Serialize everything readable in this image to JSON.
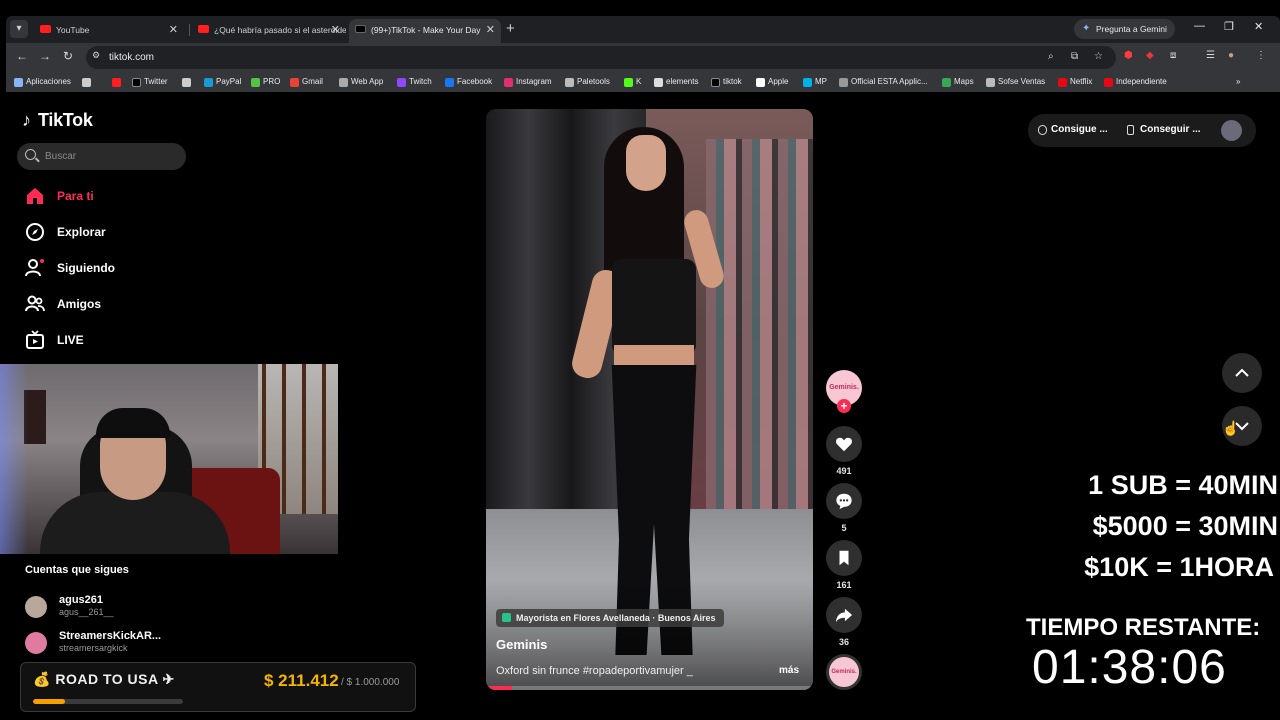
{
  "browser": {
    "tabs": [
      {
        "label": "YouTube"
      },
      {
        "label": "¿Qué habría pasado si el asteroide..."
      },
      {
        "label": "(99+)TikTok - Make Your Day"
      }
    ],
    "new_tab": "+",
    "gemini": "Pregunta a Gemini",
    "url": "tiktok.com",
    "bookmarks": [
      {
        "label": "Aplicaciones",
        "color": "#8ab4f8"
      },
      {
        "label": "",
        "color": "#ff1f1f"
      },
      {
        "label": "Twitter",
        "color": "#000000"
      },
      {
        "label": "",
        "color": "#cccccc"
      },
      {
        "label": "PayPal",
        "color": "#169bd7"
      },
      {
        "label": "PRO",
        "color": "#53c245"
      },
      {
        "label": "Gmail",
        "color": "#ea4335"
      },
      {
        "label": "Web App",
        "color": "#aaaaaa"
      },
      {
        "label": "Twitch",
        "color": "#9146ff"
      },
      {
        "label": "Facebook",
        "color": "#1877f2"
      },
      {
        "label": "Instagram",
        "color": "#e1306c"
      },
      {
        "label": "Paletools",
        "color": "#bbbbbb"
      },
      {
        "label": "K",
        "color": "#53fc18"
      },
      {
        "label": "elements",
        "color": "#dddddd"
      },
      {
        "label": "tiktok",
        "color": "#000000"
      },
      {
        "label": "Apple",
        "color": "#ffffff"
      },
      {
        "label": "MP",
        "color": "#00b1ea"
      },
      {
        "label": "Official ESTA Applic...",
        "color": "#999999"
      },
      {
        "label": "Maps",
        "color": "#34a853"
      },
      {
        "label": "Sofse Ventas",
        "color": "#bbbbbb"
      },
      {
        "label": "Netflix",
        "color": "#e50914"
      },
      {
        "label": "Independiente",
        "color": "#e50914"
      }
    ],
    "more_bookmarks": "»"
  },
  "sidebar": {
    "logo": "TikTok",
    "search_placeholder": "Buscar",
    "nav": [
      {
        "label": "Para ti",
        "icon": "home-icon",
        "active": true
      },
      {
        "label": "Explorar",
        "icon": "compass-icon",
        "active": false
      },
      {
        "label": "Siguiendo",
        "icon": "following-icon",
        "active": false
      },
      {
        "label": "Amigos",
        "icon": "friends-icon",
        "active": false
      },
      {
        "label": "LIVE",
        "icon": "live-icon",
        "active": false
      }
    ],
    "following_title": "Cuentas que sigues",
    "accounts": [
      {
        "name": "agus261",
        "handle": "agus__261__",
        "color": "#b9a79b"
      },
      {
        "name": "StreamersKickAR...",
        "handle": "streamersargkick",
        "color": "#e07aa0"
      }
    ]
  },
  "stream_overlay": {
    "road_title": "ROAD TO USA",
    "road_amount": "$ 211.412",
    "road_goal": "/ $ 1.000.000",
    "road_progress": 0.2114,
    "rules": [
      "1 SUB = 40MIN",
      "$5000 = 30MIN",
      "$10K = 1HORA"
    ],
    "timer_label": "TIEMPO RESTANTE:",
    "timer_value": "01:38:06"
  },
  "video": {
    "location": "Mayorista en Flores Avellaneda · Buenos Aires",
    "author": "Geminis",
    "description": "Oxford sin frunce #ropadeportivamujer _",
    "more": "más",
    "progress": 0.08,
    "creator_avatar_text": "Geminis.",
    "likes": "491",
    "comments": "5",
    "saves": "161",
    "shares": "36"
  },
  "header_right": {
    "get_coins": "Consigue ...",
    "get_app": "Conseguir ..."
  }
}
